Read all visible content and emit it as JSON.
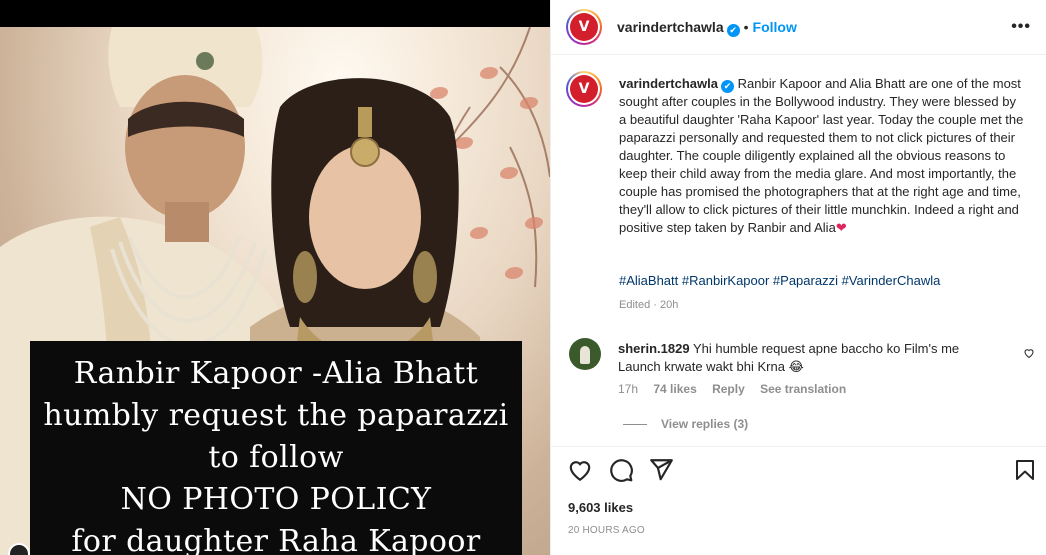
{
  "media": {
    "caption_lines": [
      "Ranbir Kapoor -Alia Bhatt",
      "humbly request the paparazzi",
      "to follow",
      "NO PHOTO POLICY",
      "for daughter Raha Kapoor"
    ]
  },
  "header": {
    "username": "varindertchawla",
    "verified": "✔",
    "separator": "•",
    "follow_label": "Follow",
    "more": "•••",
    "avatar_letter": "V"
  },
  "caption": {
    "username": "varindertchawla",
    "text": "Ranbir Kapoor and Alia Bhatt are one of the most sought after couples in the Bollywood industry. They were blessed by a beautiful daughter 'Raha Kapoor' last year. Today the couple met the paparazzi personally and requested them to not click pictures of their daughter. The couple diligently explained all the obvious reasons to keep their child away from the media glare. And most importantly, the couple has promised the photographers that at the right age and time, they'll allow to click pictures of their little munchkin. Indeed a right and positive step taken by Ranbir and Alia",
    "emoji": "❤",
    "hashtags": "#AliaBhatt #RanbirKapoor #Paparazzi #VarinderChawla",
    "edited": "Edited · 20h"
  },
  "comment": {
    "username": "sherin.1829",
    "text": "Yhi humble request apne baccho ko Film's me Launch krwate wakt bhi Krna",
    "emoji": "😂",
    "time": "17h",
    "likes": "74 likes",
    "reply": "Reply",
    "translation": "See translation",
    "view_replies": "View replies (3)"
  },
  "footer": {
    "likes": "9,603 likes",
    "time_ago": "20 HOURS AGO"
  },
  "colors": {
    "accent": "#0095f6",
    "brand": "#d31f2c",
    "hashtag": "#00376b",
    "muted": "#8e8e8e"
  }
}
